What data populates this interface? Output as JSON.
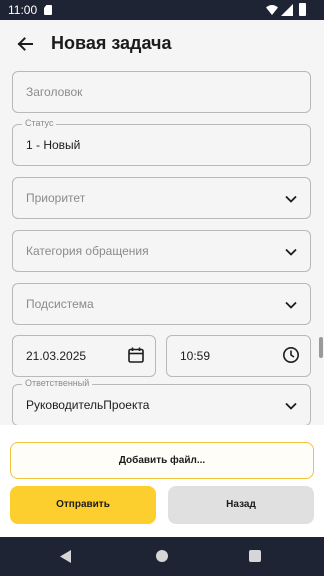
{
  "status_bar": {
    "time": "11:00"
  },
  "header": {
    "title": "Новая задача"
  },
  "form": {
    "title_field": {
      "placeholder": "Заголовок"
    },
    "status_field": {
      "label": "Статус",
      "value": "1 - Новый"
    },
    "priority_field": {
      "placeholder": "Приоритет"
    },
    "category_field": {
      "placeholder": "Категория обращения"
    },
    "subsystem_field": {
      "placeholder": "Подсистема"
    },
    "date_field": {
      "value": "21.03.2025"
    },
    "time_field": {
      "value": "10:59"
    },
    "responsible_field": {
      "label": "Ответственный",
      "value": "РуководительПроекта"
    }
  },
  "actions": {
    "add_file_label": "Добавить файл...",
    "send_label": "Отправить",
    "back_label": "Назад"
  },
  "colors": {
    "system_bar": "#1f2435",
    "accent_yellow": "#fccf2e",
    "secondary_button": "#e0e0e0",
    "field_border": "#b9b9b9"
  },
  "icons": [
    "sim-card-icon",
    "wifi-icon",
    "cellular-signal-icon",
    "battery-icon",
    "back-arrow-icon",
    "chevron-down-icon",
    "calendar-icon",
    "clock-icon",
    "nav-back-icon",
    "nav-home-icon",
    "nav-recents-icon"
  ]
}
